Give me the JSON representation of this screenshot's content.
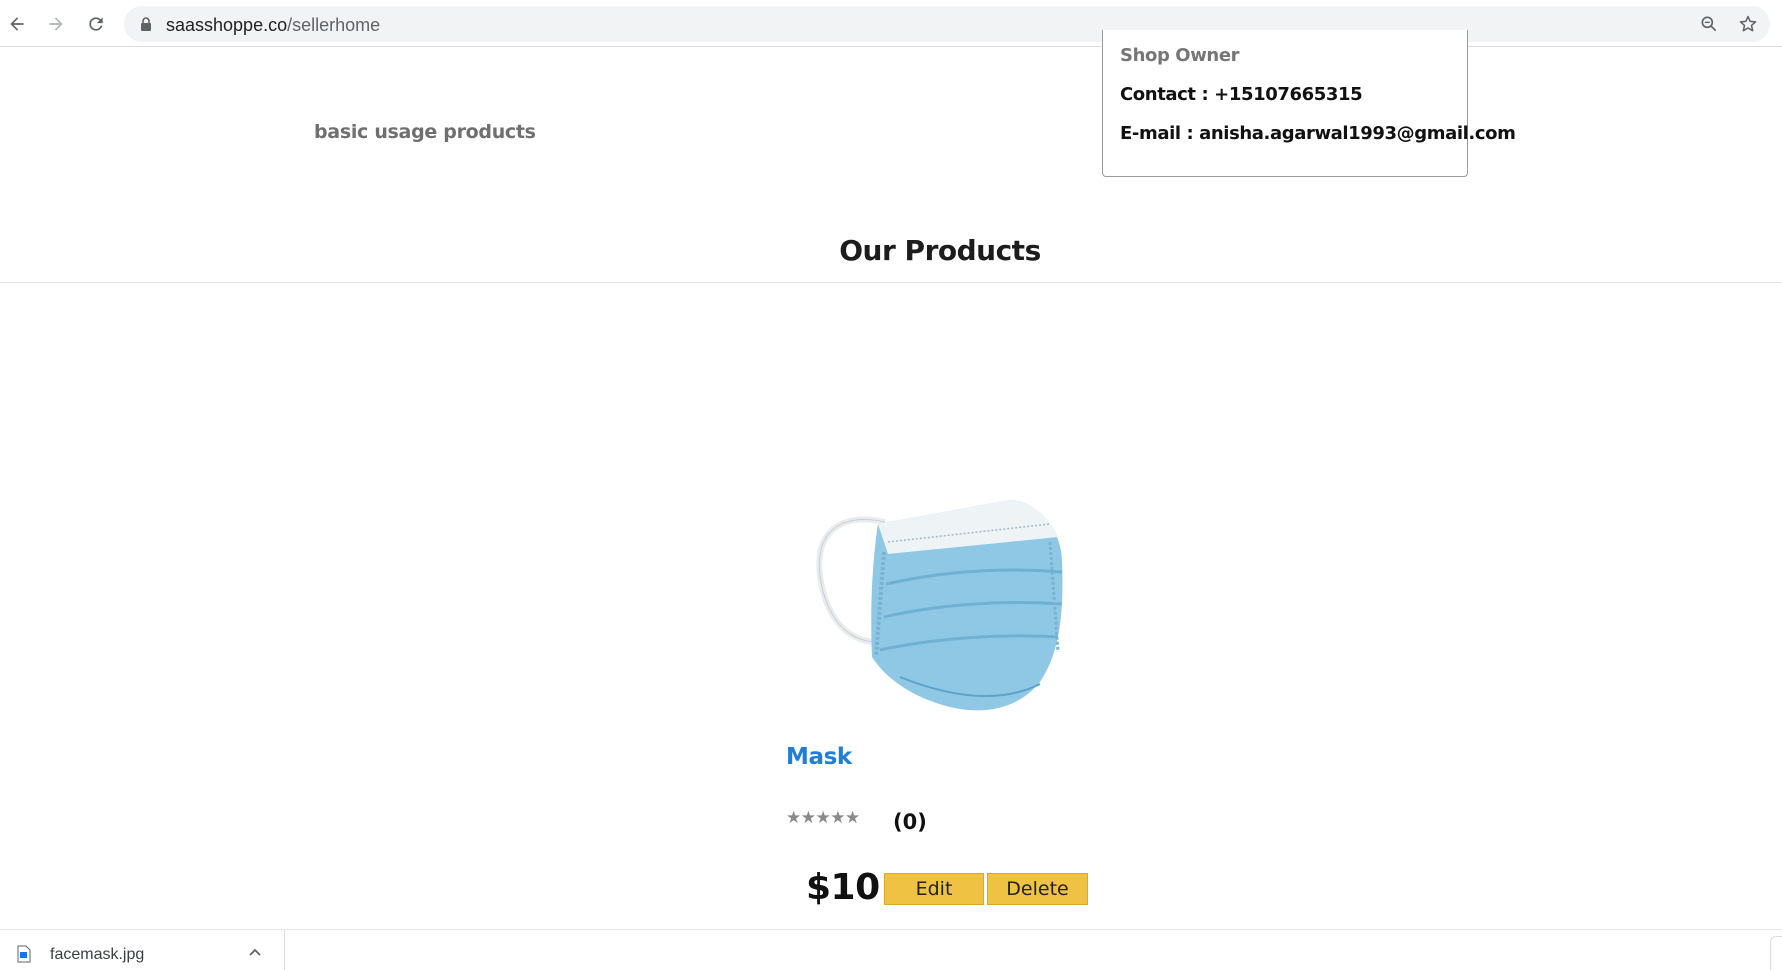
{
  "browser": {
    "url_domain": "saasshoppe.co",
    "url_path": "/sellerhome",
    "icons": [
      "back-arrow-icon",
      "forward-arrow-icon",
      "reload-icon",
      "lock-icon",
      "zoom-icon",
      "star-icon"
    ]
  },
  "shop": {
    "tagline": "basic usage products",
    "owner_title": "Shop Owner",
    "contact": "Contact : +15107665315",
    "email": "E-mail : anisha.agarwal1993@gmail.com"
  },
  "products_section": {
    "title": "Our Products"
  },
  "products": [
    {
      "name": "Mask",
      "stars": "★★★★★",
      "rating_count": "(0)",
      "rating_value": 0,
      "price": "$10",
      "edit_label": "Edit",
      "delete_label": "Delete"
    }
  ],
  "download_shelf": {
    "file_name": "facemask.jpg"
  },
  "colors": {
    "accent_button": "#f0c244",
    "product_link": "#1f7fd8"
  }
}
